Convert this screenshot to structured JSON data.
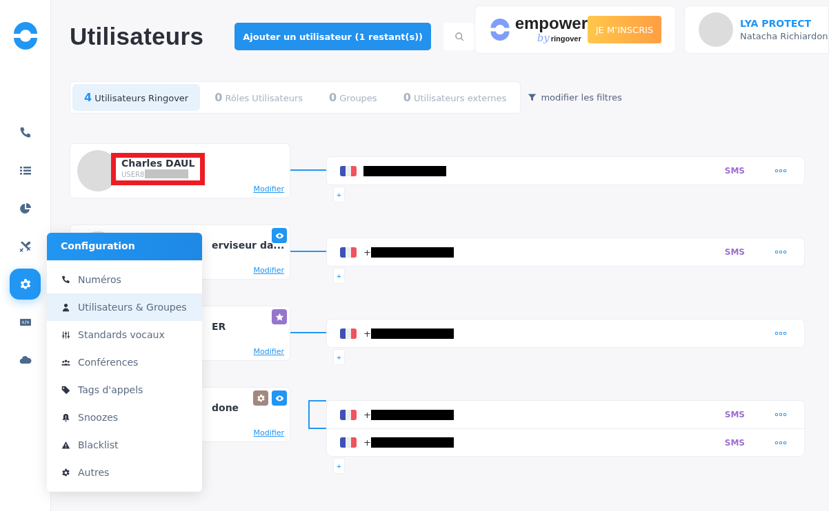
{
  "sidebar": {
    "items": [
      {
        "kind": "phone",
        "selected": false
      },
      {
        "kind": "list",
        "selected": false
      },
      {
        "kind": "pie",
        "selected": false
      },
      {
        "kind": "swords",
        "selected": false
      },
      {
        "kind": "gear",
        "selected": true
      },
      {
        "kind": "code",
        "selected": false
      },
      {
        "kind": "cloud",
        "selected": false
      }
    ]
  },
  "page_title": "Utilisateurs",
  "add_button": "Ajouter un utilisateur (**1** restant(s))",
  "promo": {
    "brand": "empower",
    "byline_script": "by",
    "byline": "ringover",
    "button": "JE M’INSCRIS"
  },
  "profile": {
    "company": "LYA PROTECT",
    "name": "Natacha Richiardon"
  },
  "tabs": [
    {
      "count": "4",
      "label": "Utilisateurs Ringover",
      "selected": true
    },
    {
      "count": "0",
      "label": "Rôles Utilisateurs",
      "selected": false
    },
    {
      "count": "0",
      "label": "Groupes",
      "selected": false
    },
    {
      "count": "0",
      "label": "Utilisateurs externes",
      "selected": false
    }
  ],
  "filter_link": "modifier les filtres",
  "users": [
    {
      "name": "Charles DAUL",
      "login": "USER8",
      "redacted": true,
      "edit": "Modifier",
      "add": "+",
      "numbers": [
        {
          "sms": "SMS"
        }
      ]
    },
    {
      "name": "erviseur da...",
      "edit": "Modifier",
      "badges": [
        {
          "kind": "eye",
          "color": "#2196f3"
        }
      ],
      "add": "+",
      "numbers": [
        {
          "prefix": "+",
          "sms": "SMS"
        }
      ]
    },
    {
      "name": "ER",
      "edit": "Modifier",
      "badges": [
        {
          "kind": "star",
          "color": "#9575cd"
        }
      ],
      "add": "+",
      "numbers": [
        {
          "prefix": "+"
        }
      ]
    },
    {
      "name": "done",
      "edit": "Modifier",
      "badges": [
        {
          "kind": "gear",
          "color": "#a1887f"
        },
        {
          "kind": "eye",
          "color": "#2196f3"
        }
      ],
      "add": "+",
      "numbers": [
        {
          "prefix": "+",
          "sms": "SMS"
        },
        {
          "prefix": "+",
          "sms": "SMS"
        }
      ]
    }
  ],
  "menu": {
    "title": "Configuration",
    "items": [
      {
        "kind": "phone",
        "label": "Numéros",
        "selected": false
      },
      {
        "kind": "user",
        "label": "Utilisateurs & Groupes",
        "selected": true
      },
      {
        "kind": "sliders",
        "label": "Standards vocaux",
        "selected": false
      },
      {
        "kind": "people",
        "label": "Conférences",
        "selected": false
      },
      {
        "kind": "tag",
        "label": "Tags d'appels",
        "selected": false
      },
      {
        "kind": "bell",
        "label": "Snoozes",
        "selected": false
      },
      {
        "kind": "warning",
        "label": "Blacklist",
        "selected": false
      },
      {
        "kind": "gear",
        "label": "Autres",
        "selected": false
      }
    ]
  }
}
